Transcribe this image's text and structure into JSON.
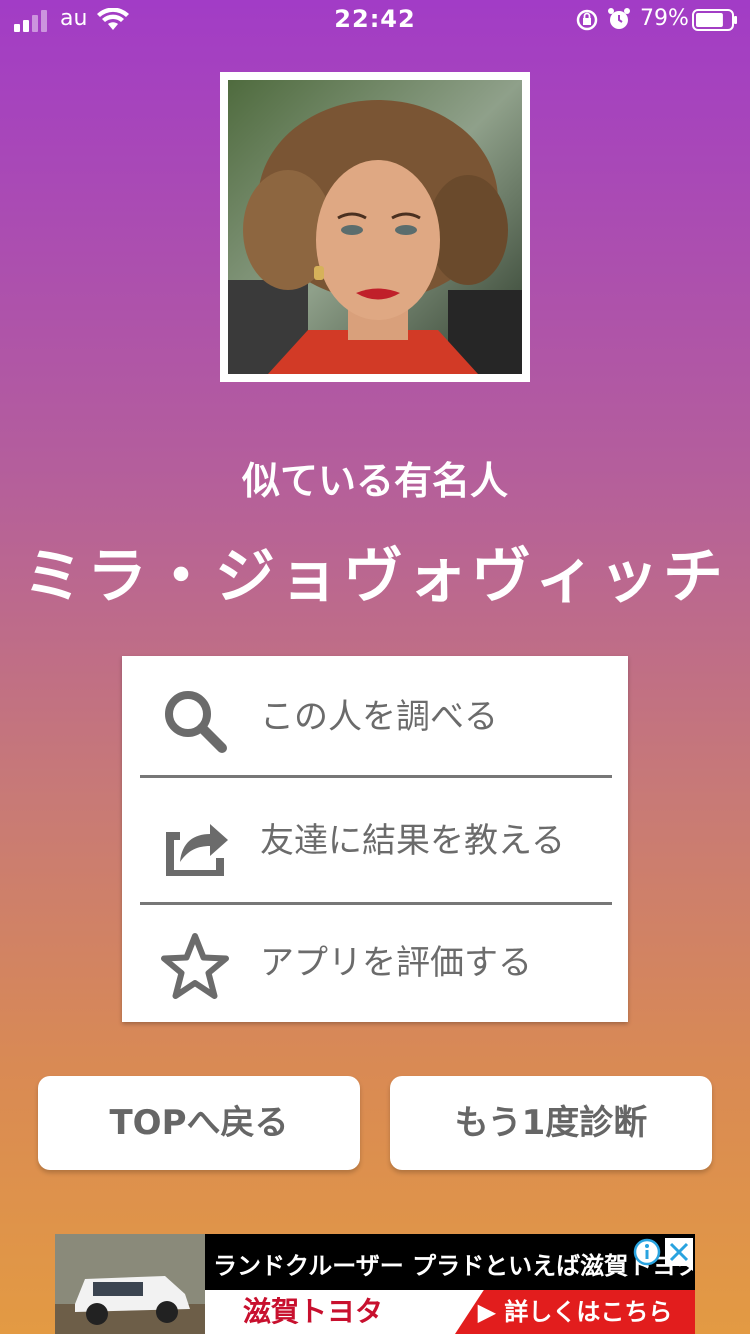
{
  "status_bar": {
    "carrier": "au",
    "time": "22:42",
    "battery_percent": "79%",
    "battery_level": 0.79,
    "icons": [
      "signal-icon",
      "wifi-icon",
      "rotation-lock-icon",
      "alarm-icon",
      "battery-icon"
    ]
  },
  "result": {
    "subtitle": "似ている有名人",
    "celebrity_name": "ミラ・ジョヴォヴィッチ"
  },
  "menu": {
    "items": [
      {
        "label": "この人を調べる",
        "icon": "search-icon"
      },
      {
        "label": "友達に結果を教える",
        "icon": "share-icon"
      },
      {
        "label": "アプリを評価する",
        "icon": "star-icon"
      }
    ]
  },
  "buttons": {
    "top_label": "TOPへ戻る",
    "retry_label": "もう1度診断"
  },
  "ad": {
    "headline": "ランドクルーザー プラドといえば滋賀トヨタ",
    "brand": "滋賀トヨタ",
    "cta": "▶ 詳しくはこちら",
    "icons": [
      "ad-info-icon",
      "ad-close-icon"
    ]
  },
  "colors": {
    "gradient_top": "#a23cc6",
    "gradient_bottom": "#e39a43",
    "menu_text": "#6b6b6b",
    "ad_cta": "#e21d1d"
  }
}
